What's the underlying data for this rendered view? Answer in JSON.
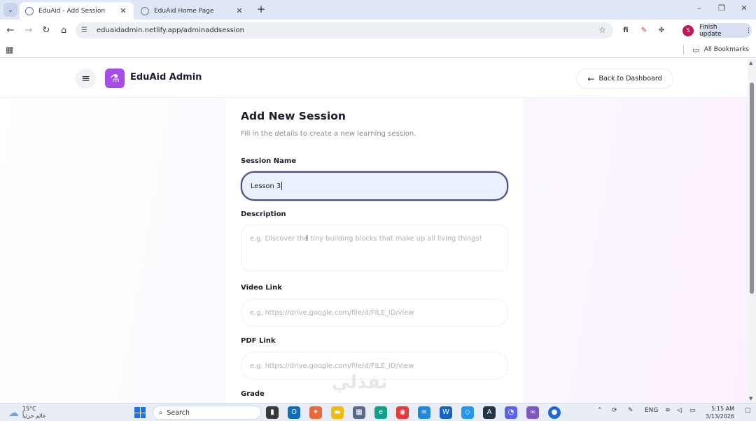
{
  "browser": {
    "tabs": [
      {
        "title": "EduAid - Add Session",
        "active": true
      },
      {
        "title": "EduAid Home Page",
        "active": false
      }
    ],
    "url": "eduaidadmin.netlify.app/adminaddsession",
    "finish_update_label": "Finish update",
    "profile_initial": "S",
    "all_bookmarks_label": "All Bookmarks"
  },
  "app": {
    "brand": "EduAid Admin",
    "back_button_label": "Back to Dashboard"
  },
  "form": {
    "title": "Add New Session",
    "subtitle": "Fill in the details to create a new learning session.",
    "session_name": {
      "label": "Session Name",
      "value": "Lesson 3"
    },
    "description": {
      "label": "Description",
      "placeholder": "e.g. Discover the tiny building blocks that make up all living things!"
    },
    "video_link": {
      "label": "Video Link",
      "placeholder": "e.g. https://drive.google.com/file/d/FILE_ID/view"
    },
    "pdf_link": {
      "label": "PDF Link",
      "placeholder": "e.g. https://drive.google.com/file/d/FILE_ID/view"
    },
    "grade": {
      "label": "Grade"
    }
  },
  "watermark": "نفذلي",
  "taskbar": {
    "weather_temp": "15°C",
    "weather_desc": "غائم جزئياً",
    "search_label": "Search",
    "language": "ENG",
    "time": "5:15 AM",
    "date": "3/13/2026"
  }
}
